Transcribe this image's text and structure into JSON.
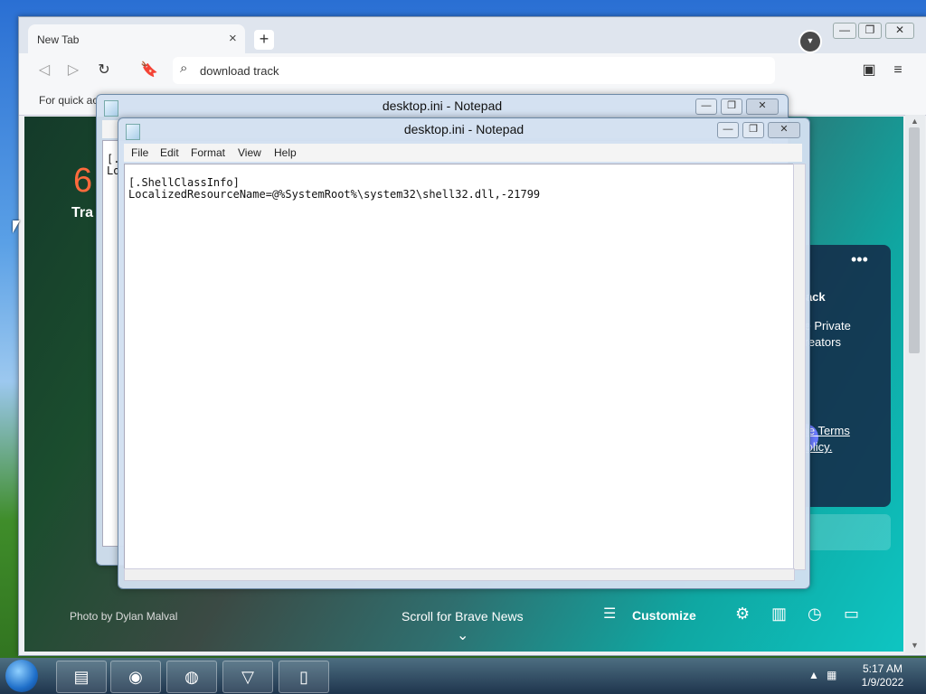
{
  "browser": {
    "tab_title": "New Tab",
    "tab_close": "×",
    "new_tab": "+",
    "window_controls": {
      "minimize": "—",
      "restore": "❐",
      "close": "✕"
    },
    "address": "download track",
    "bookmarks_text": "For quick ac",
    "ntp": {
      "big_number": "6",
      "big_text": "Tra",
      "card_lines": [
        "back",
        "ve Private",
        "creators",
        "the Terms",
        "Policy."
      ],
      "card_pill": "s",
      "photo_credit": "Photo by Dylan Malval",
      "scroll_news": "Scroll for Brave News",
      "customize": "Customize"
    }
  },
  "notepad_back": {
    "title": "desktop.ini - Notepad",
    "controls": {
      "minimize": "—",
      "restore": "❐",
      "close": "✕"
    },
    "visible_text": "[.\nLo"
  },
  "notepad_front": {
    "title": "desktop.ini - Notepad",
    "controls": {
      "minimize": "—",
      "restore": "❐",
      "close": "✕"
    },
    "menu": [
      "File",
      "Edit",
      "Format",
      "View",
      "Help"
    ],
    "content": "[.ShellClassInfo]\nLocalizedResourceName=@%SystemRoot%\\system32\\shell32.dll,-21799"
  },
  "taskbar": {
    "time": "5:17 AM",
    "date": "1/9/2022"
  }
}
